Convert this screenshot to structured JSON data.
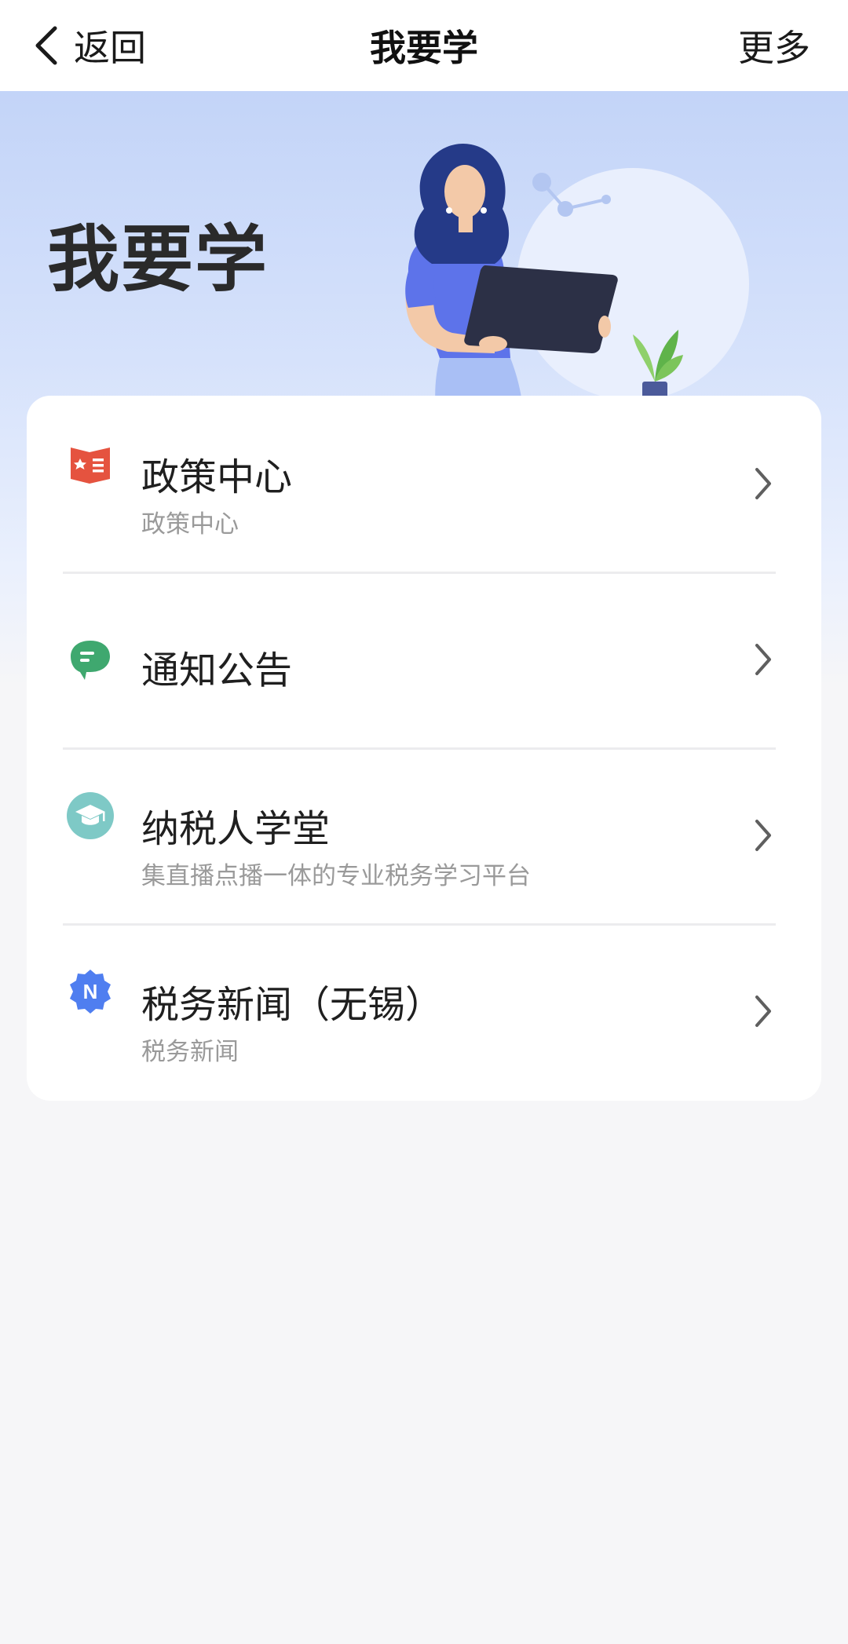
{
  "navbar": {
    "back_label": "返回",
    "title": "我要学",
    "more_label": "更多"
  },
  "hero": {
    "title": "我要学"
  },
  "menu": {
    "items": [
      {
        "title": "政策中心",
        "subtitle": "政策中心",
        "icon": "policy-book-icon",
        "icon_color": "#e5533f"
      },
      {
        "title": "通知公告",
        "subtitle": "",
        "icon": "chat-bubble-icon",
        "icon_color": "#3fa86f"
      },
      {
        "title": "纳税人学堂",
        "subtitle": "集直播点播一体的专业税务学习平台",
        "icon": "graduation-cap-icon",
        "icon_color": "#7ec9c6"
      },
      {
        "title": "税务新闻（无锡）",
        "subtitle": "税务新闻",
        "icon": "news-badge-icon",
        "icon_color": "#4f7ef0"
      }
    ]
  },
  "colors": {
    "accent": "#4f7ef0",
    "page_bg": "#f6f6f8",
    "hero_bg": "#c3d4f8"
  }
}
